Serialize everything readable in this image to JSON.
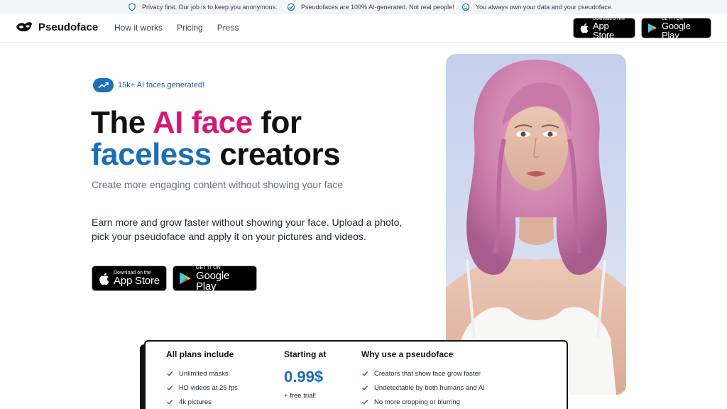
{
  "topbar": {
    "items": [
      {
        "icon": "shield-icon",
        "text": "Privacy first. Our job is to keep you anonymous."
      },
      {
        "icon": "check-badge-icon",
        "text": "Pseudofaces are 100% AI-generated. Not real people!"
      },
      {
        "icon": "smile-icon",
        "text": "You always own your data and your pseudoface."
      }
    ]
  },
  "nav": {
    "brand": "Pseudoface",
    "links": [
      "How it works",
      "Pricing",
      "Press"
    ],
    "app_store": {
      "small": "Download on the",
      "large": "App Store"
    },
    "google_play": {
      "small": "GET IT ON",
      "large": "Google Play"
    }
  },
  "hero": {
    "badge": "15k+ AI faces generated!",
    "title": {
      "w1": "The ",
      "w2": "AI face",
      "w3": " for",
      "w4": "faceless",
      "w5": " creators"
    },
    "subtitle": "Create more engaging content without showing your face",
    "body": "Earn more and grow faster without showing your face. Upload a photo, pick your pseudoface and apply it on your pictures and videos.",
    "app_store": {
      "small": "Download on the",
      "large": "App Store"
    },
    "google_play": {
      "small": "GET IT ON",
      "large": "Google Play"
    }
  },
  "pricing": {
    "col1_title": "All plans include",
    "col1_items": [
      "Unlimited masks",
      "HD videos at 25 fps",
      "4k pictures"
    ],
    "col2_title": "Starting at",
    "price": "0.99$",
    "trial": "+ free trial!",
    "col3_title": "Why use a pseudoface",
    "col3_items": [
      "Creators that show face grow faster",
      "Undetectable by both humans and AI",
      "No more cropping or blurring"
    ]
  },
  "colors": {
    "accent_pink": "#d4177a",
    "accent_blue": "#1b6fb5"
  }
}
